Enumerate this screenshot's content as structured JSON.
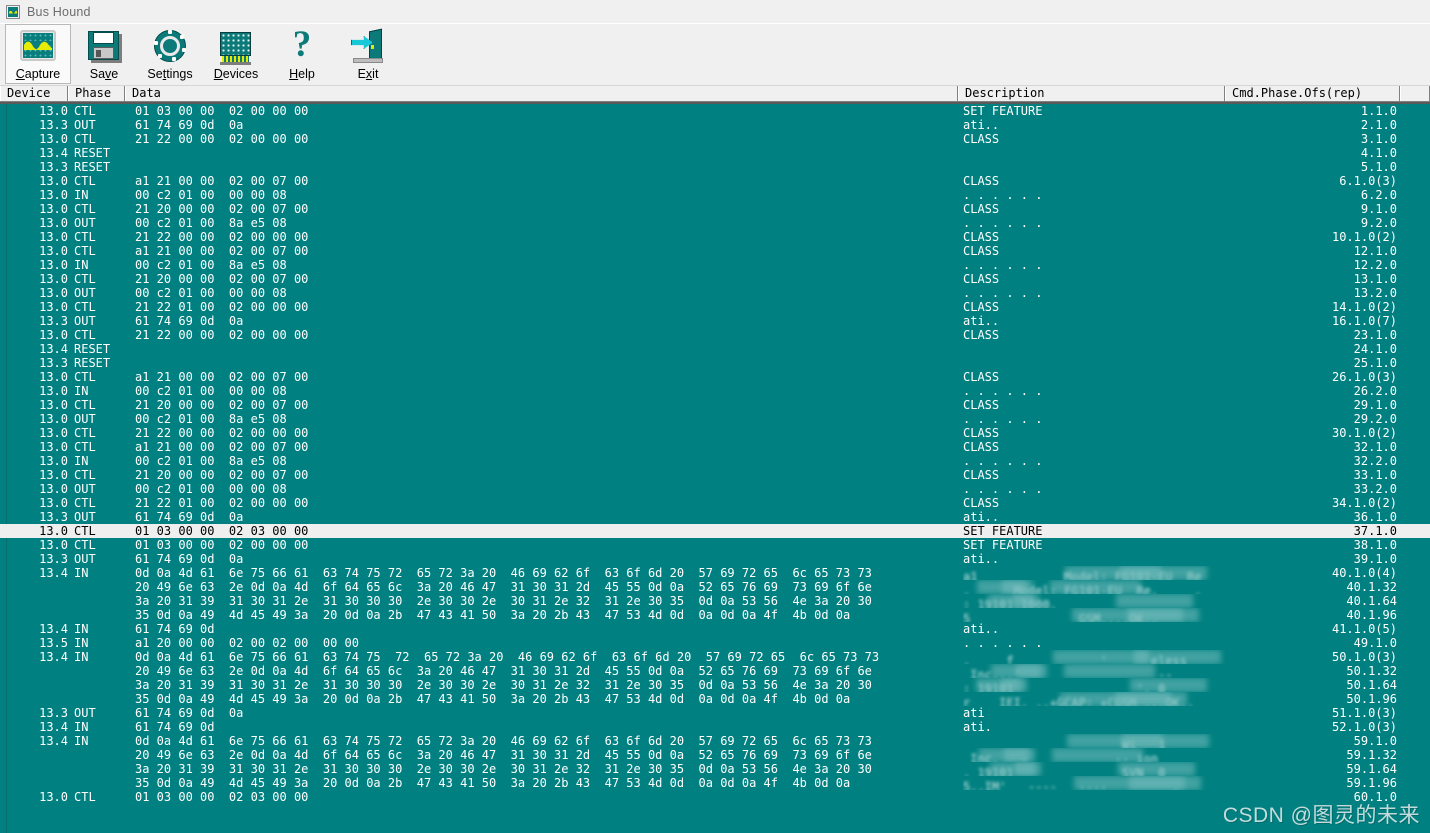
{
  "window": {
    "title": "Bus Hound",
    "icon": "scope-icon"
  },
  "toolbar": {
    "buttons": [
      {
        "id": "capture",
        "label": "Capture",
        "accel": "C",
        "icon": "scope-icon",
        "selected": true
      },
      {
        "id": "save",
        "label": "Save",
        "accel": "v",
        "icon": "floppy-disk-icon",
        "selected": false
      },
      {
        "id": "settings",
        "label": "Settings",
        "accel": "t",
        "icon": "gear-icon",
        "selected": false
      },
      {
        "id": "devices",
        "label": "Devices",
        "accel": "D",
        "icon": "chip-icon",
        "selected": false
      },
      {
        "id": "help",
        "label": "Help",
        "accel": "H",
        "icon": "question-mark-icon",
        "selected": false
      },
      {
        "id": "exit",
        "label": "Exit",
        "accel": "x",
        "icon": "exit-door-icon",
        "selected": false
      }
    ]
  },
  "table": {
    "columns": [
      "Device",
      "Phase",
      "Data",
      "Description",
      "Cmd.Phase.Ofs(rep)"
    ],
    "rows": [
      {
        "device": "13.0",
        "phase": "CTL",
        "data": "01 03 00 00  02 00 00 00",
        "desc": "SET FEATURE",
        "cmd": "1.1.0"
      },
      {
        "device": "13.3",
        "phase": "OUT",
        "data": "61 74 69 0d  0a",
        "desc": "ati..",
        "cmd": "2.1.0"
      },
      {
        "device": "13.0",
        "phase": "CTL",
        "data": "21 22 00 00  02 00 00 00",
        "desc": "CLASS",
        "cmd": "3.1.0"
      },
      {
        "device": "13.4",
        "phase": "RESET",
        "data": "",
        "desc": "",
        "cmd": "4.1.0"
      },
      {
        "device": "13.3",
        "phase": "RESET",
        "data": "",
        "desc": "",
        "cmd": "5.1.0"
      },
      {
        "device": "13.0",
        "phase": "CTL",
        "data": "a1 21 00 00  02 00 07 00",
        "desc": "CLASS",
        "cmd": "6.1.0(3)"
      },
      {
        "device": "13.0",
        "phase": "IN",
        "data": "00 c2 01 00  00 00 08",
        "desc": ". . . . . .",
        "cmd": "6.2.0"
      },
      {
        "device": "13.0",
        "phase": "CTL",
        "data": "21 20 00 00  02 00 07 00",
        "desc": "CLASS",
        "cmd": "9.1.0"
      },
      {
        "device": "13.0",
        "phase": "OUT",
        "data": "00 c2 01 00  8a e5 08",
        "desc": ". . . . . .",
        "cmd": "9.2.0"
      },
      {
        "device": "13.0",
        "phase": "CTL",
        "data": "21 22 00 00  02 00 00 00",
        "desc": "CLASS",
        "cmd": "10.1.0(2)"
      },
      {
        "device": "13.0",
        "phase": "CTL",
        "data": "a1 21 00 00  02 00 07 00",
        "desc": "CLASS",
        "cmd": "12.1.0"
      },
      {
        "device": "13.0",
        "phase": "IN",
        "data": "00 c2 01 00  8a e5 08",
        "desc": ". . . . . .",
        "cmd": "12.2.0"
      },
      {
        "device": "13.0",
        "phase": "CTL",
        "data": "21 20 00 00  02 00 07 00",
        "desc": "CLASS",
        "cmd": "13.1.0"
      },
      {
        "device": "13.0",
        "phase": "OUT",
        "data": "00 c2 01 00  00 00 08",
        "desc": ". . . . . .",
        "cmd": "13.2.0"
      },
      {
        "device": "13.0",
        "phase": "CTL",
        "data": "21 22 01 00  02 00 00 00",
        "desc": "CLASS",
        "cmd": "14.1.0(2)"
      },
      {
        "device": "13.3",
        "phase": "OUT",
        "data": "61 74 69 0d  0a",
        "desc": "ati..",
        "cmd": "16.1.0(7)"
      },
      {
        "device": "13.0",
        "phase": "CTL",
        "data": "21 22 00 00  02 00 00 00",
        "desc": "CLASS",
        "cmd": "23.1.0"
      },
      {
        "device": "13.4",
        "phase": "RESET",
        "data": "",
        "desc": "",
        "cmd": "24.1.0"
      },
      {
        "device": "13.3",
        "phase": "RESET",
        "data": "",
        "desc": "",
        "cmd": "25.1.0"
      },
      {
        "device": "13.0",
        "phase": "CTL",
        "data": "a1 21 00 00  02 00 07 00",
        "desc": "CLASS",
        "cmd": "26.1.0(3)"
      },
      {
        "device": "13.0",
        "phase": "IN",
        "data": "00 c2 01 00  00 00 08",
        "desc": ". . . . . .",
        "cmd": "26.2.0"
      },
      {
        "device": "13.0",
        "phase": "CTL",
        "data": "21 20 00 00  02 00 07 00",
        "desc": "CLASS",
        "cmd": "29.1.0"
      },
      {
        "device": "13.0",
        "phase": "OUT",
        "data": "00 c2 01 00  8a e5 08",
        "desc": ". . . . . .",
        "cmd": "29.2.0"
      },
      {
        "device": "13.0",
        "phase": "CTL",
        "data": "21 22 00 00  02 00 00 00",
        "desc": "CLASS",
        "cmd": "30.1.0(2)"
      },
      {
        "device": "13.0",
        "phase": "CTL",
        "data": "a1 21 00 00  02 00 07 00",
        "desc": "CLASS",
        "cmd": "32.1.0"
      },
      {
        "device": "13.0",
        "phase": "IN",
        "data": "00 c2 01 00  8a e5 08",
        "desc": ". . . . . .",
        "cmd": "32.2.0"
      },
      {
        "device": "13.0",
        "phase": "CTL",
        "data": "21 20 00 00  02 00 07 00",
        "desc": "CLASS",
        "cmd": "33.1.0"
      },
      {
        "device": "13.0",
        "phase": "OUT",
        "data": "00 c2 01 00  00 00 08",
        "desc": ". . . . . .",
        "cmd": "33.2.0"
      },
      {
        "device": "13.0",
        "phase": "CTL",
        "data": "21 22 01 00  02 00 00 00",
        "desc": "CLASS",
        "cmd": "34.1.0(2)"
      },
      {
        "device": "13.3",
        "phase": "OUT",
        "data": "61 74 69 0d  0a",
        "desc": "ati..",
        "cmd": "36.1.0"
      },
      {
        "device": "13.0",
        "phase": "CTL",
        "data": "01 03 00 00  02 03 00 00",
        "desc": "SET FEATURE",
        "cmd": "37.1.0",
        "selected": true
      },
      {
        "device": "13.0",
        "phase": "CTL",
        "data": "01 03 00 00  02 00 00 00",
        "desc": "SET FEATURE",
        "cmd": "38.1.0"
      },
      {
        "device": "13.3",
        "phase": "OUT",
        "data": "61 74 69 0d  0a",
        "desc": "ati..",
        "cmd": "39.1.0"
      },
      {
        "device": "13.4",
        "phase": "IN",
        "data": "0d 0a 4d 61  6e 75 66 61  63 74 75 72  65 72 3a 20  46 69 62 6f  63 6f 6d 20  57 69 72 65  6c 65 73 73",
        "desc": "",
        "cmd": "40.1.0(4)",
        "blur": "a1            Model: FG101-EU  Re        ess"
      },
      {
        "device": "",
        "phase": "",
        "data": "20 49 6e 63  2e 0d 0a 4d  6f 64 65 6c  3a 20 46 47  31 30 31 2d  45 55 0d 0a  52 65 76 69  73 69 6f 6e",
        "desc": "",
        "cmd": "40.1.32",
        "blur": ". _    Model: FG101-EU  Re.     ."
      },
      {
        "device": "",
        "phase": "",
        "data": "3a 20 31 39  31 30 31 2e  31 30 30 30  2e 30 30 2e  30 31 2e 32  31 2e 30 35  0d 0a 53 56  4e 3a 20 30",
        "desc": "",
        "cmd": "40.1.64",
        "blur": ": 19101.1000."
      },
      {
        "device": "",
        "phase": "",
        "data": "35 0d 0a 49  4d 45 49 3a  20 0d 0a 2b  47 43 41 50  3a 20 2b 43  47 53 4d 0d  0a 0d 0a 4f  4b 0d 0a",
        "desc": "",
        "cmd": "40.1.96",
        "blur": "5               GSM....OK.."
      },
      {
        "device": "13.4",
        "phase": "IN",
        "data": "61 74 69 0d",
        "desc": "ati..",
        "cmd": "41.1.0(5)"
      },
      {
        "device": "13.5",
        "phase": "IN",
        "data": "a1 20 00 00  02 00 02 00  00 00",
        "desc": ". . . . . .",
        "cmd": "49.1.0"
      },
      {
        "device": "13.4",
        "phase": "IN",
        "data": "0d 0a 4d 61  6e 75 66 61  63 74 75  72  65 72 3a 20  46 69 62 6f  63 6f 6d 20  57 69 72 65  6c 65 73 73",
        "desc": "",
        "cmd": "50.1.0(3)",
        "blur": ".     f            '      eless"
      },
      {
        "device": "",
        "phase": "",
        "data": "20 49 6e 63  2e 0d 0a 4d  6f 64 65 6c  3a 20 46 47  31 30 31 2d  45 55 0d 0a  52 65 76 69  73 69 6f 6e",
        "desc": "",
        "cmd": "50.1.32",
        "blur": " Inc...'                   --"
      },
      {
        "device": "",
        "phase": "",
        "data": "3a 20 31 39  31 30 31 2e  31 30 30 30  2e 30 30 2e  30 31 2e 32  31 2e 30 35  0d 0a 53 56  4e 3a 20 30",
        "desc": "",
        "cmd": "50.1.64",
        "blur": ": 19101                 '. 0"
      },
      {
        "device": "",
        "phase": "",
        "data": "35 0d 0a 49  4d 45 49 3a  20 0d 0a 2b  47 43 41 50  3a 20 2b 43  47 53 4d 0d  0a 0d 0a 4f  4b 0d 0a",
        "desc": "",
        "cmd": "50.1.96",
        "blur": "r    IEI. ..+GCAP: +CGSM ...OK.."
      },
      {
        "device": "13.3",
        "phase": "OUT",
        "data": "61 74 69 0d  0a",
        "desc": "ati",
        "cmd": "51.1.0(3)"
      },
      {
        "device": "13.4",
        "phase": "IN",
        "data": "61 74 69 0d",
        "desc": "ati.",
        "cmd": "52.1.0(3)"
      },
      {
        "device": "13.4",
        "phase": "IN",
        "data": "0d 0a 4d 61  6e 75 66 61  63 74 75 72  65 72 3a 20  46 69 62 6f  63 6f 6d 20  57 69 72 65  6c 65 73 73",
        "desc": "",
        "cmd": "59.1.0",
        "blur": "                      Wi   1"
      },
      {
        "device": "",
        "phase": "",
        "data": "20 49 6e 63  2e 0d 0a 4d  6f 64 65 6c  3a 20 46 47  31 30 31 2d  45 55 0d 0a  52 65 76 69  73 69 6f 6e",
        "desc": "",
        "cmd": "59.1.32",
        "blur": " Inc.   -            -- ion"
      },
      {
        "device": "",
        "phase": "",
        "data": "3a 20 31 39  31 30 31 2e  31 30 30 30  2e 30 30 2e  30 31 2e 32  31 2e 30 35  0d 0a 53 56  4e 3a 20 30",
        "desc": "",
        "cmd": "59.1.64",
        "blur": ". 19101               SVN  0"
      },
      {
        "device": "",
        "phase": "",
        "data": "35 0d 0a 49  4d 45 49 3a  20 0d 0a 2b  47 43 41 50  3a 20 2b 43  47 53 4d 0d  0a 0d 0a 4f  4b 0d 0a",
        "desc": "",
        "cmd": "59.1.96",
        "blur": "5..IM'   ----   ----         ."
      },
      {
        "device": "13.0",
        "phase": "CTL",
        "data": "01 03 00 00  02 03 00 00",
        "desc": "",
        "cmd": "60.1.0"
      }
    ]
  },
  "watermark": {
    "text": "CSDN @图灵的未来"
  },
  "colors": {
    "teal": "#008080",
    "chrome": "#f0f0f0",
    "selection": "#efefef",
    "text": "#ffffff"
  }
}
